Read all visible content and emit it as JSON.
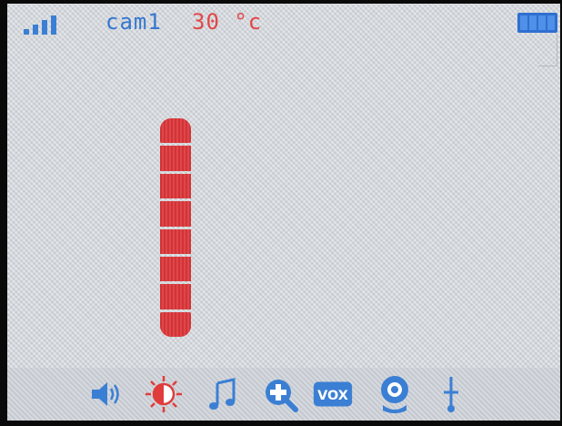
{
  "status_bar": {
    "signal_bars": 4,
    "camera_name": "cam1",
    "temperature": "30 °c",
    "battery_icon": "battery-icon"
  },
  "volume_meter": {
    "segments_total": 8,
    "segments_lit": 8,
    "level": 1.0
  },
  "bottom_menu": {
    "items": [
      {
        "icon": "speaker-volume-icon",
        "active": false
      },
      {
        "icon": "brightness-icon",
        "active": true
      },
      {
        "icon": "music-note-icon",
        "active": false
      },
      {
        "icon": "zoom-in-icon",
        "active": false
      },
      {
        "icon": "vox-icon",
        "label": "VOX",
        "active": false
      },
      {
        "icon": "camera-icon",
        "active": false
      },
      {
        "icon": "thermometer-icon",
        "active": false
      }
    ]
  },
  "colors": {
    "accent_blue": "#3577cf",
    "alert_red": "#e0393d",
    "screen_bg": "#d9dde2"
  }
}
